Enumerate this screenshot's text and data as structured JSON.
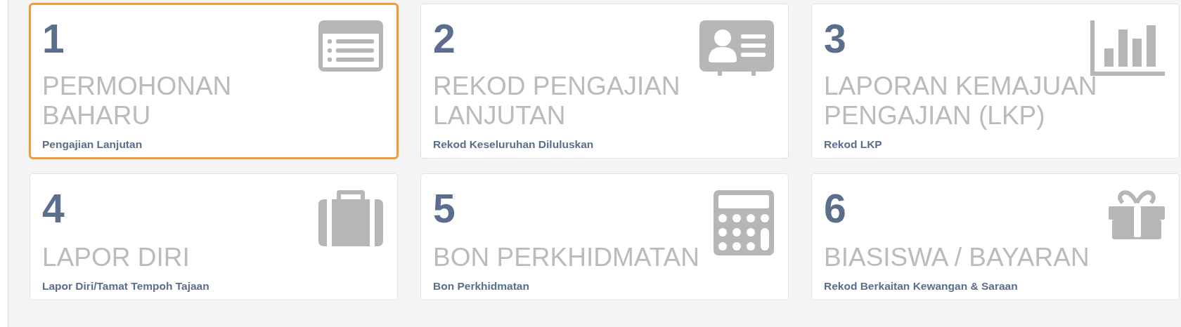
{
  "cards": [
    {
      "number": "1",
      "title": "PERMOHONAN BAHARU",
      "subtitle": "Pengajian Lanjutan",
      "selected": true
    },
    {
      "number": "2",
      "title": "REKOD PENGAJIAN LANJUTAN",
      "subtitle": "Rekod Keseluruhan Diluluskan",
      "selected": false
    },
    {
      "number": "3",
      "title": "LAPORAN KEMAJUAN PENGAJIAN (LKP)",
      "subtitle": "Rekod LKP",
      "selected": false
    },
    {
      "number": "4",
      "title": "LAPOR DIRI",
      "subtitle": "Lapor Diri/Tamat Tempoh Tajaan",
      "selected": false
    },
    {
      "number": "5",
      "title": "BON PERKHIDMATAN",
      "subtitle": "Bon Perkhidmatan",
      "selected": false
    },
    {
      "number": "6",
      "title": "BIASISWA / BAYARAN",
      "subtitle": "Rekod Berkaitan Kewangan & Saraan",
      "selected": false
    }
  ]
}
